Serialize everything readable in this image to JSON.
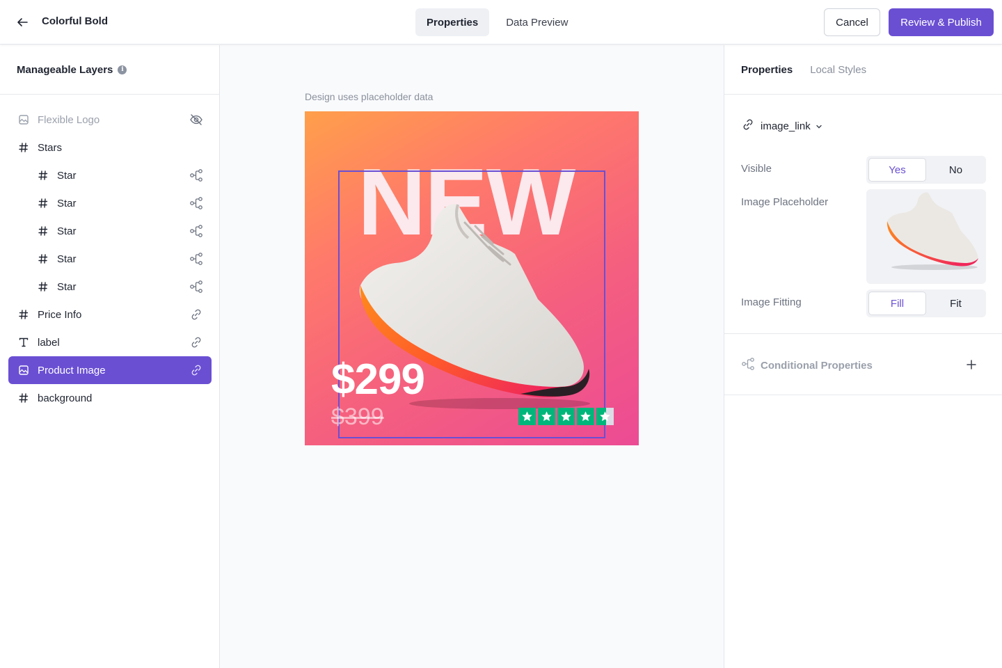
{
  "header": {
    "title": "Colorful Bold",
    "tabs": [
      {
        "label": "Properties",
        "active": true
      },
      {
        "label": "Data Preview",
        "active": false
      }
    ],
    "cancel_label": "Cancel",
    "publish_label": "Review & Publish",
    "accent_color": "#6a4fd3"
  },
  "layers_panel": {
    "title": "Manageable Layers",
    "items": [
      {
        "label": "Flexible Logo",
        "icon": "image-icon",
        "action": "eye-off-icon",
        "state": "hidden"
      },
      {
        "label": "Stars",
        "icon": "hash-icon"
      },
      {
        "label": "Star",
        "icon": "hash-icon",
        "action": "conditional-icon"
      },
      {
        "label": "Star",
        "icon": "hash-icon",
        "action": "conditional-icon"
      },
      {
        "label": "Star",
        "icon": "hash-icon",
        "action": "conditional-icon"
      },
      {
        "label": "Star",
        "icon": "hash-icon",
        "action": "conditional-icon"
      },
      {
        "label": "Star",
        "icon": "hash-icon",
        "action": "conditional-icon"
      },
      {
        "label": "Price Info",
        "icon": "hash-icon",
        "action": "link-icon"
      },
      {
        "label": "label",
        "icon": "text-icon",
        "action": "link-icon"
      },
      {
        "label": "Product Image",
        "icon": "image-icon",
        "action": "link-icon",
        "state": "selected"
      },
      {
        "label": "background",
        "icon": "hash-icon"
      }
    ]
  },
  "canvas": {
    "note": "Design uses placeholder data",
    "artwork": {
      "headline": "NEW",
      "price": "$299",
      "old_price": "$399",
      "rating_stars": 4.5,
      "star_color": "#00b67a"
    }
  },
  "properties_panel": {
    "tabs": [
      {
        "label": "Properties",
        "active": true
      },
      {
        "label": "Local Styles",
        "active": false
      }
    ],
    "binding_name": "image_link",
    "visible": {
      "label": "Visible",
      "options": [
        "Yes",
        "No"
      ],
      "selected": "Yes"
    },
    "image_placeholder_label": "Image Placeholder",
    "image_fitting": {
      "label": "Image Fitting",
      "options": [
        "Fill",
        "Fit"
      ],
      "selected": "Fill"
    },
    "conditional_properties_label": "Conditional Properties"
  }
}
